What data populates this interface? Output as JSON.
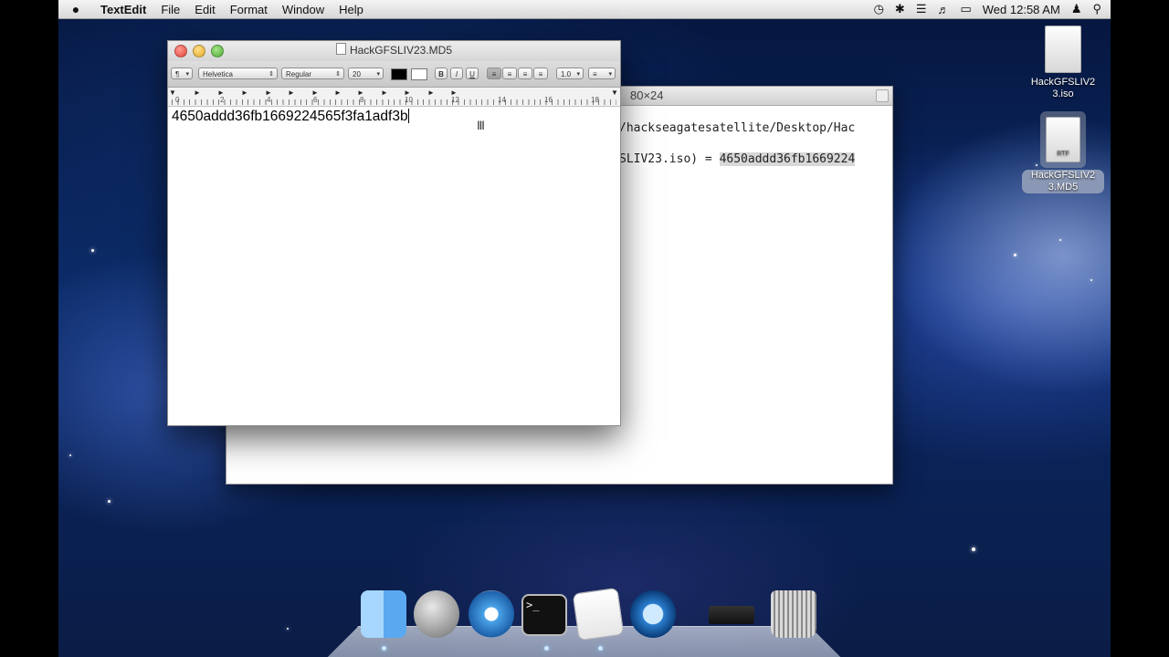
{
  "menubar": {
    "apple": "",
    "app": "TextEdit",
    "items": [
      "File",
      "Edit",
      "Format",
      "Window",
      "Help"
    ],
    "clock": "Wed 12:58 AM"
  },
  "terminal": {
    "title": "80×24",
    "line1": "/hackseagatesatellite/Desktop/Hac",
    "line2_prefix": "SLIV23.iso) = ",
    "line2_hash": "4650addd36fb1669224"
  },
  "textedit": {
    "title": "HackGFSLIV23.MD5",
    "toolbar": {
      "paragraph": "¶",
      "font_family": "Helvetica",
      "font_style": "Regular",
      "font_size": "20",
      "bold": "B",
      "italic": "I",
      "underline": "U",
      "line_spacing": "1.0"
    },
    "ruler_numbers": [
      "0",
      "2",
      "4",
      "6",
      "8",
      "10",
      "12",
      "14",
      "16",
      "18"
    ],
    "content": "4650addd36fb1669224565f3fa1adf3b"
  },
  "desktop_icons": [
    {
      "label": "HackGFSLIV2\n3.iso"
    },
    {
      "label": "HackGFSLIV2\n3.MD5",
      "tag": "RTF"
    }
  ]
}
